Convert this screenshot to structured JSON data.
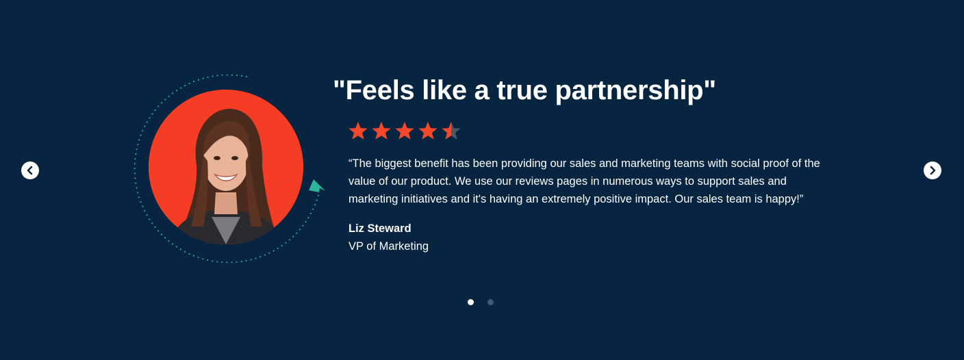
{
  "carousel": {
    "prev_icon": "chevron-left-icon",
    "next_icon": "chevron-right-icon",
    "slide_count": 2,
    "active_slide": 1
  },
  "testimonial": {
    "headline": "\"Feels like a true partnership\"",
    "rating": 4.5,
    "rating_max": 5,
    "quote": "“The biggest benefit has been providing our sales and marketing teams with social proof of the value of our product. We use our reviews pages in numerous ways to support sales and marketing initiatives and it's having an extremely positive impact. Our sales team is happy!”",
    "author_name": "Liz Steward",
    "author_title": "VP of Marketing"
  },
  "colors": {
    "background": "#072440",
    "star": "#f5472a",
    "star_empty": "#4a5a6a",
    "portrait_bg": "#f53d26",
    "accent_ring": "#2bb79a",
    "dot_active": "#ffffff",
    "dot_inactive": "#3e5a75"
  }
}
